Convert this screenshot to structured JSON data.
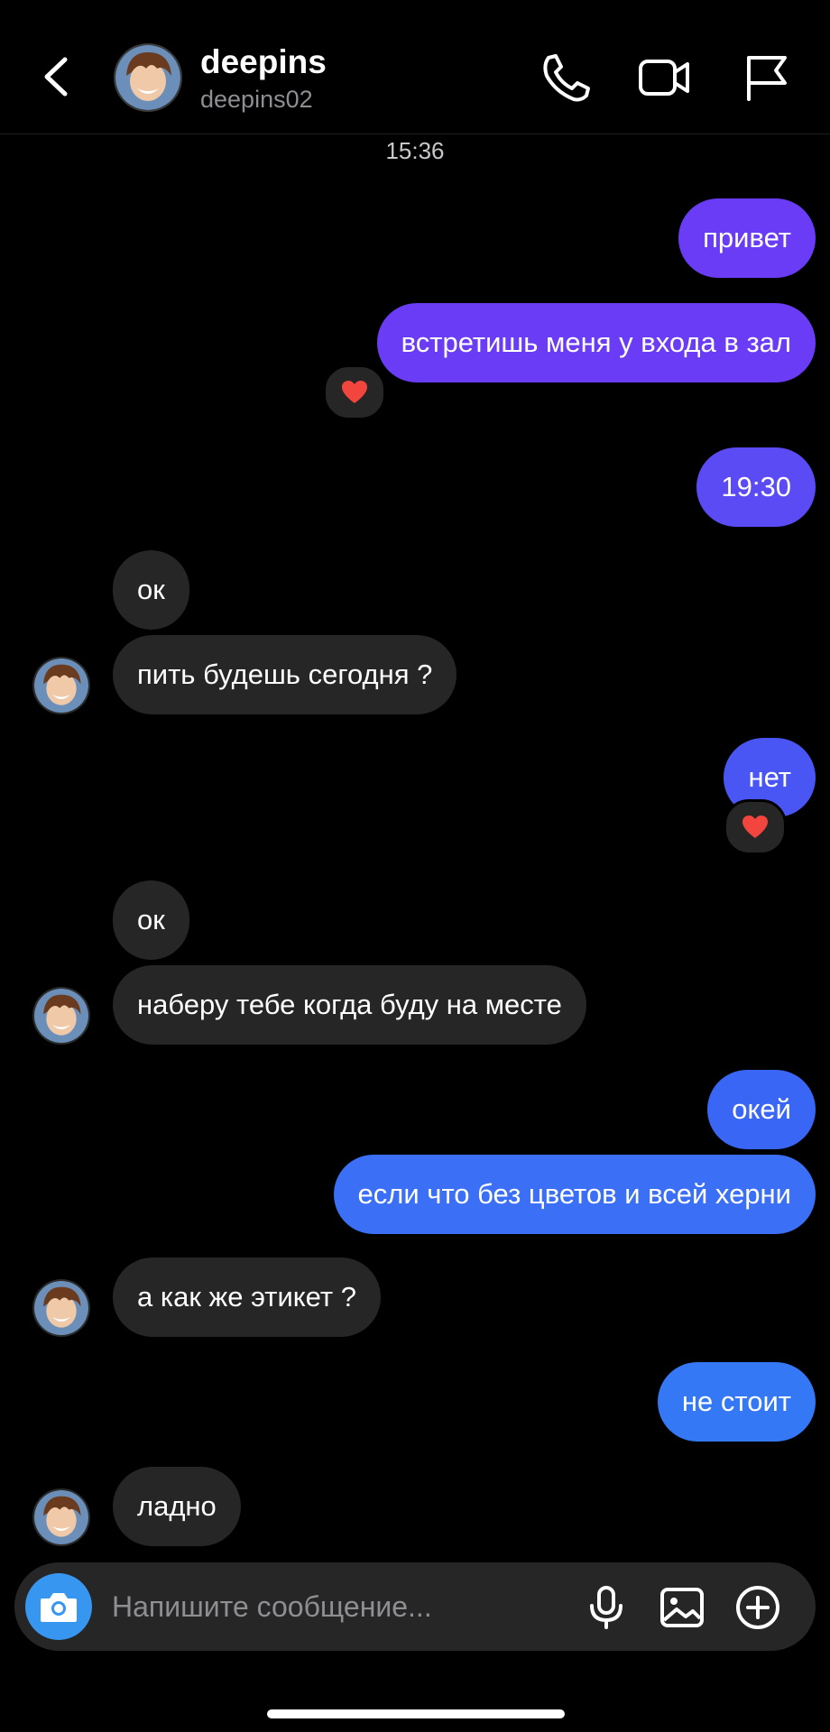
{
  "header": {
    "name": "deepins",
    "username": "deepins02"
  },
  "chat": {
    "timestamp": "15:36",
    "messages": [
      {
        "dir": "out",
        "text": "привет"
      },
      {
        "dir": "out",
        "text": "встретишь меня у входа в зал",
        "reaction": "❤️"
      },
      {
        "dir": "out",
        "text": "19:30"
      },
      {
        "dir": "in",
        "text": "ок"
      },
      {
        "dir": "in",
        "text": "пить будешь сегодня ?"
      },
      {
        "dir": "out",
        "text": "нет",
        "reaction": "❤️"
      },
      {
        "dir": "in",
        "text": "ок"
      },
      {
        "dir": "in",
        "text": "наберу тебе когда буду на месте"
      },
      {
        "dir": "out",
        "text": "окей"
      },
      {
        "dir": "out",
        "text": "если что без цветов и всей херни"
      },
      {
        "dir": "in",
        "text": "а как же этикет ?"
      },
      {
        "dir": "out",
        "text": "не стоит"
      },
      {
        "dir": "in",
        "text": "ладно"
      }
    ]
  },
  "composer": {
    "placeholder": "Напишите сообщение..."
  },
  "icons": {
    "back": "chevron-left-icon",
    "call": "phone-icon",
    "video": "video-camera-icon",
    "report": "flag-icon",
    "camera": "camera-icon",
    "mic": "microphone-icon",
    "gallery": "image-icon",
    "more": "plus-circle-icon",
    "reaction": "heart-emoji"
  },
  "colors": {
    "background": "#000000",
    "incoming_bubble": "#262626",
    "outgoing_purple": "#6a3cf5",
    "outgoing_blue": "#3478f6",
    "camera_button": "#3797f0"
  }
}
